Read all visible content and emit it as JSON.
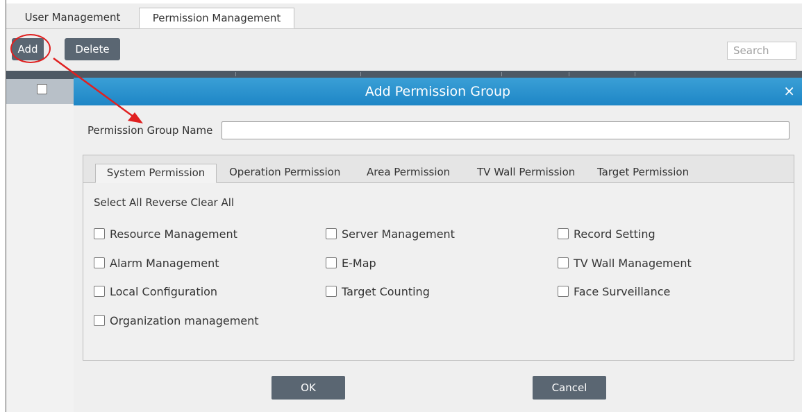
{
  "top_tabs": [
    "User Management",
    "Permission Management"
  ],
  "toolbar": {
    "add_label": "Add",
    "delete_label": "Delete",
    "search_placeholder": "Search"
  },
  "dialog": {
    "title": "Add Permission Group",
    "close_glyph": "×",
    "group_name_label": "Permission Group Name",
    "group_name_value": "",
    "tabs": [
      "System Permission",
      "Operation Permission",
      "Area Permission",
      "TV Wall Permission",
      "Target Permission"
    ],
    "bulk": {
      "select_all": "Select All",
      "reverse": "Reverse",
      "clear_all": "Clear All"
    },
    "permissions": [
      "Resource Management",
      "Server Management",
      "Record Setting",
      "Alarm Management",
      "E-Map",
      "TV Wall Management",
      "Local Configuration",
      "Target Counting",
      "Face Surveillance",
      "Organization management"
    ],
    "ok_label": "OK",
    "cancel_label": "Cancel"
  },
  "colors": {
    "title_bar": "#2a93cf",
    "button": "#5a6672",
    "highlight": "#e02020"
  }
}
